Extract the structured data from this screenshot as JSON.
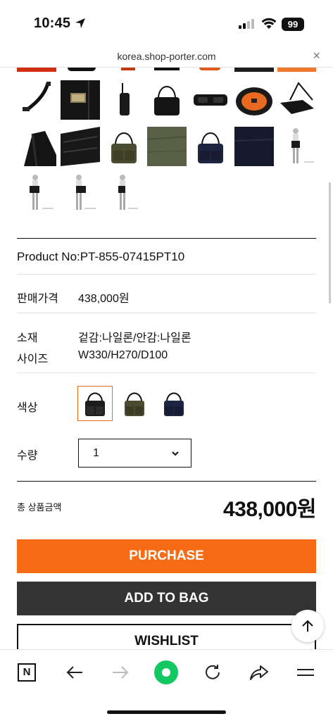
{
  "status": {
    "time": "10:45",
    "battery": "99"
  },
  "browser": {
    "url": "korea.shop-porter.com",
    "close": "×"
  },
  "thumbnails": [
    {
      "name": "shoulder-strap",
      "bg": "#ffffff"
    },
    {
      "name": "front-pocket-label",
      "bg": "#1a1a1a"
    },
    {
      "name": "side-view",
      "bg": "#ffffff"
    },
    {
      "name": "back-view",
      "bg": "#ffffff"
    },
    {
      "name": "top-view",
      "bg": "#ffffff"
    },
    {
      "name": "interior-orange",
      "bg": "#e07020"
    },
    {
      "name": "angle-view",
      "bg": "#ffffff"
    },
    {
      "name": "strap-detail",
      "bg": "#222222"
    },
    {
      "name": "pocket-detail",
      "bg": "#1b1b1b"
    },
    {
      "name": "olive-front",
      "bg": "#ffffff"
    },
    {
      "name": "olive-fabric",
      "bg": "#5a6045"
    },
    {
      "name": "navy-front",
      "bg": "#ffffff"
    },
    {
      "name": "navy-fabric",
      "bg": "#1a2030"
    },
    {
      "name": "model-front",
      "bg": "#ffffff"
    },
    {
      "name": "model-side-a",
      "bg": "#ffffff"
    },
    {
      "name": "model-side-b",
      "bg": "#ffffff"
    },
    {
      "name": "model-back",
      "bg": "#ffffff"
    }
  ],
  "product": {
    "number_label": "Product No:",
    "number_value": "PT-855-07415PT10",
    "price_label": "판매가격",
    "price_value": "438,000원",
    "material_label": "소재",
    "material_value": "겉감:나일론/안감:나일론",
    "size_label": "사이즈",
    "size_value": "W330/H270/D100",
    "color_label": "색상",
    "colors": [
      {
        "name": "black",
        "hex": "#1c1c1c",
        "selected": true
      },
      {
        "name": "olive",
        "hex": "#4a4a2e",
        "selected": false
      },
      {
        "name": "navy",
        "hex": "#1e2540",
        "selected": false
      }
    ],
    "quantity_label": "수량",
    "quantity_value": "1"
  },
  "total": {
    "label": "총 상품금액",
    "value": "438,000원"
  },
  "buttons": {
    "purchase": "PURCHASE",
    "add_to_bag": "ADD TO BAG",
    "wishlist": "WISHLIST"
  },
  "toolbar": {
    "brand_glyph": "N",
    "accent": "#12c862"
  },
  "colors": {
    "purchase": "#f76b15",
    "bag": "#333333",
    "selected_border": "#f26b1d"
  }
}
